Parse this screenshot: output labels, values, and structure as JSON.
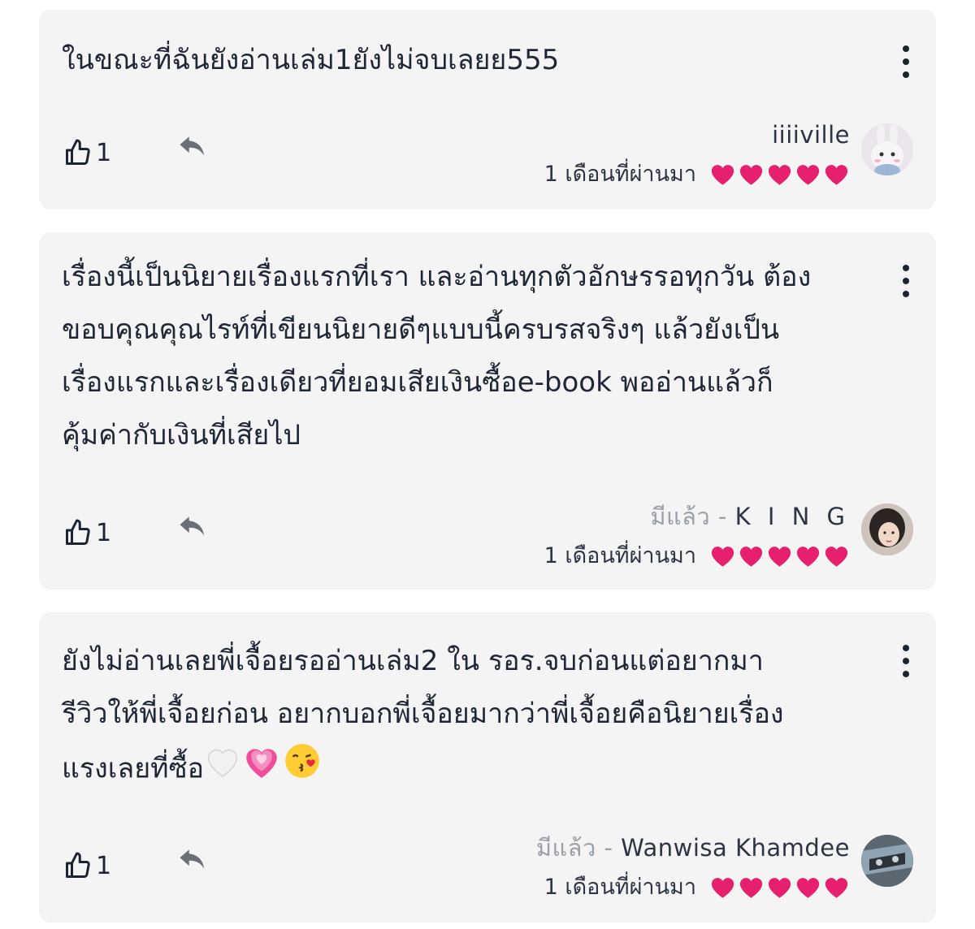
{
  "comments": [
    {
      "text": "ในขณะที่ฉันยังอ่านเล่ม1ยังไม่จบเลยย555",
      "likes": "1",
      "author": "iiiiville",
      "status": "",
      "time": "1 เดือนที่ผ่านมา",
      "rating": 5
    },
    {
      "text": "เรื่องนี้เป็นนิยายเรื่องแรกที่เรา และอ่านทุกตัวอักษรรอทุกวัน ต้อง\nขอบคุณคุณไรท์ที่เขียนนิยายดีๆแบบนี้ครบรสจริงๆ แล้วยังเป็น\nเรื่องแรกและเรื่องเดียวที่ยอมเสียเงินซื้อe-book พออ่านแล้วก็\nคุ้มค่ากับเงินที่เสียไป",
      "likes": "1",
      "author": "K I N G",
      "status": "มีแล้ว - ",
      "time": "1 เดือนที่ผ่านมา",
      "rating": 5
    },
    {
      "text": "ยังไม่อ่านเลยพี่เจื้อยรออ่านเล่ม2 ใน รอร.จบก่อนแต่อยากมา\nรีวิวให้พี่เจื้อยก่อน อยากบอกพี่เจื้อยมากว่าพี่เจื้อยคือนิยายเรื่อง\nแรงเลยที่ซื้อ",
      "likes": "1",
      "author": "Wanwisa Khamdee",
      "status": "มีแล้ว - ",
      "time": "1 เดือนที่ผ่านมา",
      "rating": 5
    }
  ],
  "heart_color": "#e6206e",
  "icons": {
    "like": "thumbs-up-icon",
    "reply": "reply-icon",
    "more": "more-vertical-icon",
    "emoji_trailing": [
      "white-heart-emoji",
      "pink-heart-emoji",
      "kiss-face-emoji"
    ]
  }
}
